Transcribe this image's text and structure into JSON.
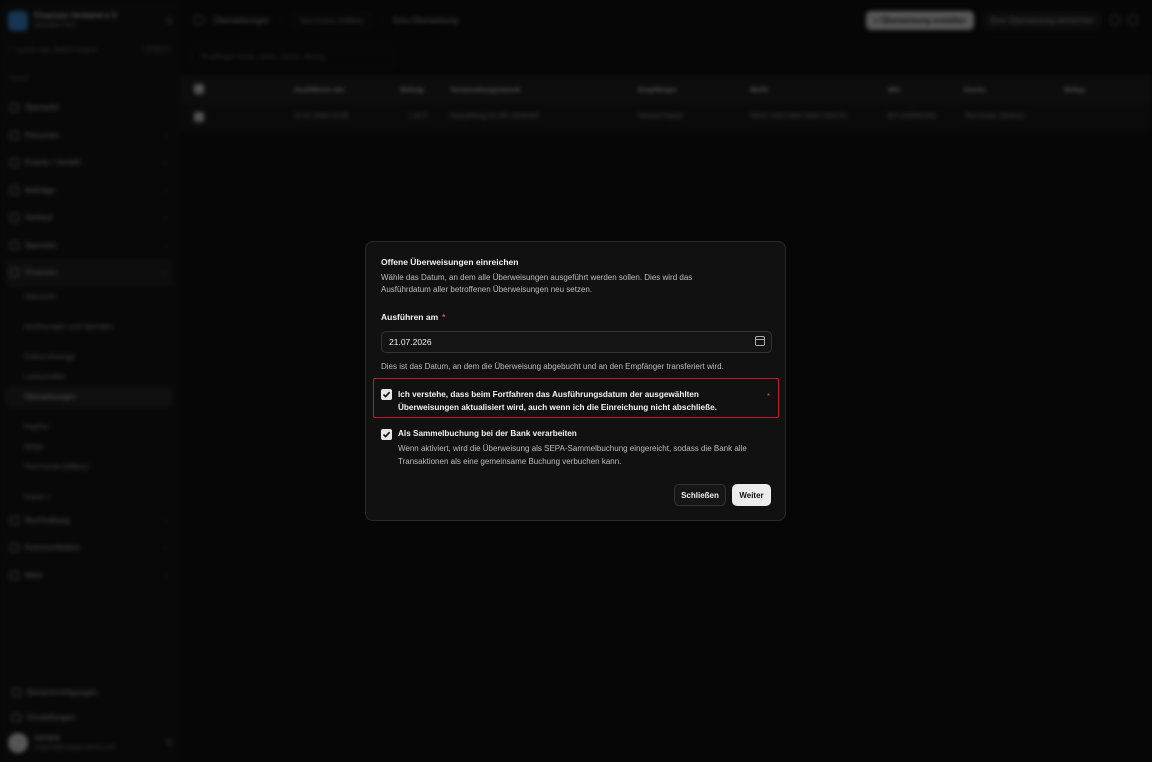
{
  "sidebar": {
    "org_name": "Finanzen Verband e.V.",
    "org_sub": "Standort Test",
    "search_placeholder": "Suche oder Befehl eingeb.",
    "search_shortcut": "STRG K",
    "section_label": "campai",
    "items": [
      {
        "label": "Startseite"
      },
      {
        "label": "Personen"
      },
      {
        "label": "Events / Verleih"
      },
      {
        "label": "Beiträge"
      },
      {
        "label": "Verkauf"
      },
      {
        "label": "Spenden"
      },
      {
        "label": "Finanzen"
      }
    ],
    "finance_sub": [
      {
        "label": "Übersicht"
      },
      {
        "label": "Rechnungen und Spenden"
      },
      {
        "label": "Online-Einzüge"
      },
      {
        "label": "Lastschriften"
      },
      {
        "label": "Überweisungen"
      },
      {
        "label": "PayPal"
      },
      {
        "label": "Stripe"
      },
      {
        "label": "Test-Konto (Offline)"
      },
      {
        "label": "Kasse 1"
      }
    ],
    "items_after": [
      {
        "label": "Buchhaltung"
      },
      {
        "label": "Kommunikation"
      },
      {
        "label": "Mehr"
      }
    ],
    "bottom": [
      {
        "label": "Benachrichtigungen"
      },
      {
        "label": "Einstellungen"
      }
    ],
    "user_name": "campai",
    "user_email": "support@campai-demo.com"
  },
  "topbar": {
    "crumb_1": "Überweisungen",
    "crumb_chip": "Test-Konto (Offline)",
    "crumb_3": "Eine Überweisung",
    "create_button": "+ Überweisung erstellen",
    "submit_one_button": "Eine Überweisung einreichen"
  },
  "filter_placeholder": "Empfänger Name, IBAN, Zweck, Betrag",
  "table": {
    "headers": [
      "Ausführen am",
      "Betrag",
      "Verwendungszweck",
      "Empfänger",
      "IBAN",
      "BIC",
      "Konto",
      "Beleg"
    ],
    "row": [
      "21.07.2026 02:00",
      "1,00 €",
      "Auszahlung für RE-2026/002",
      "Simone Kaiser",
      "DE02 1203 0000 0000 2020 51",
      "BYLADEM1001",
      "Test-Konto (Online)",
      ""
    ]
  },
  "modal": {
    "title": "Offene Überweisungen einreichen",
    "description": "Wähle das Datum, an dem alle Überweisungen ausgeführt werden sollen. Dies wird das Ausführdatum aller betroffenen Überweisungen neu setzen.",
    "date_label": "Ausführen am",
    "required_mark": "*",
    "date_value": "21.07.2026",
    "date_help": "Dies ist das Datum, an dem die Überweisung abgebucht und an den Empfänger transferiert wird.",
    "ack_text": "Ich verstehe, dass beim Fortfahren das Ausführungsdatum der ausgewählten Überweisungen aktualisiert wird, auch wenn ich die Einreichung nicht abschließe.",
    "ack_checked": true,
    "batch_title": "Als Sammelbuchung bei der Bank verarbeiten",
    "batch_desc": "Wenn aktiviert, wird die Überweisung als SEPA-Sammelbuchung eingereicht, sodass die Bank alle Transaktionen als eine gemeinsame Buchung verbuchen kann.",
    "batch_checked": true,
    "close_button": "Schließen",
    "next_button": "Weiter"
  },
  "colors": {
    "required": "#e5484d",
    "highlight_border": "#c0192b",
    "primary_button": "#ececec"
  }
}
